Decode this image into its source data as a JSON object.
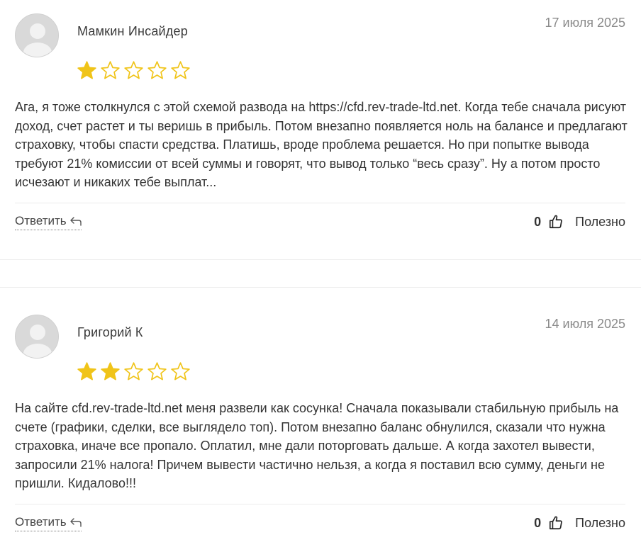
{
  "reviews": [
    {
      "author": "Мамкин Инсайдер",
      "date": "17 июля 2025",
      "rating": 1,
      "max_rating": 5,
      "text": "Ага, я тоже столкнулся с этой схемой развода на https://cfd.rev-trade-ltd.net. Когда тебе сначала рисуют доход, счет растет и ты веришь в прибыль. Потом внезапно появляется ноль на балансе и предлагают страховку, чтобы спасти средства. Платишь, вроде проблема решается. Но при попытке вывода требуют 21% комиссии от всей суммы и говорят, что вывод только “весь сразу”. Ну а потом просто исчезают и никаких тебе выплат...",
      "reply_label": "Ответить",
      "likes": "0",
      "useful_label": "Полезно"
    },
    {
      "author": "Григорий К",
      "date": "14 июля 2025",
      "rating": 2,
      "max_rating": 5,
      "text": "На сайте cfd.rev-trade-ltd.net меня развели как сосунка! Сначала показывали стабильную прибыль на счете (графики, сделки, все выглядело топ). Потом внезапно баланс обнулился, сказали что нужна страховка, иначе все пропало. Оплатил, мне дали поторговать дальше. А когда захотел вывести, запросили 21% налога! Причем вывести частично нельзя, а когда я поставил всю сумму, деньги не пришли. Кидалово!!!",
      "reply_label": "Ответить",
      "likes": "0",
      "useful_label": "Полезно"
    }
  ],
  "icons": {
    "avatar": "user-placeholder-icon",
    "star_filled": "star-filled-icon",
    "star_empty": "star-outline-icon",
    "reply": "reply-arrow-icon",
    "like": "thumbs-up-icon"
  },
  "colors": {
    "star": "#f0c419",
    "text": "#333333",
    "date": "#8a8a8a",
    "divider": "#ececec",
    "avatar_bg": "#d9d9d9"
  }
}
